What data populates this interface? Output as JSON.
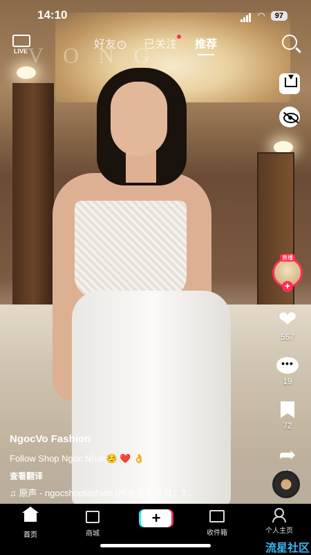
{
  "status_bar": {
    "time": "14:10",
    "battery": "97"
  },
  "top_nav": {
    "live_label": "LIVE",
    "tabs": [
      {
        "label": "好友",
        "active": false,
        "has_info": true
      },
      {
        "label": "已关注",
        "active": false,
        "has_dot": true
      },
      {
        "label": "推荐",
        "active": true
      }
    ],
    "info_glyph": "i"
  },
  "video": {
    "watermark_text": "VONG"
  },
  "right_rail": {
    "live_badge": "直播",
    "follow_plus": "+",
    "likes": "557",
    "comments": "19",
    "favorites": "72",
    "shares": "16",
    "comment_glyph": "•••"
  },
  "caption": {
    "author": "NgocVo Fashion",
    "description": "Follow Shop Ngoc Nhak☺️ ❤️ 👌",
    "translate": "查看翻译",
    "music": "♫ 原声 - ngocshopfashion (所含音乐来自：T..."
  },
  "tabbar": {
    "items": [
      {
        "label": "首页",
        "icon": "home-icon",
        "active": true
      },
      {
        "label": "商城",
        "icon": "shop-bag-icon"
      },
      {
        "label": "+",
        "icon": "create-plus-icon"
      },
      {
        "label": "收件箱",
        "icon": "inbox-icon"
      },
      {
        "label": "个人主页",
        "icon": "profile-icon"
      }
    ]
  },
  "corner_watermark": "流星社区",
  "colors": {
    "accent": "#ff2d55",
    "cyan": "#25f4ee",
    "red": "#fe2c55"
  }
}
